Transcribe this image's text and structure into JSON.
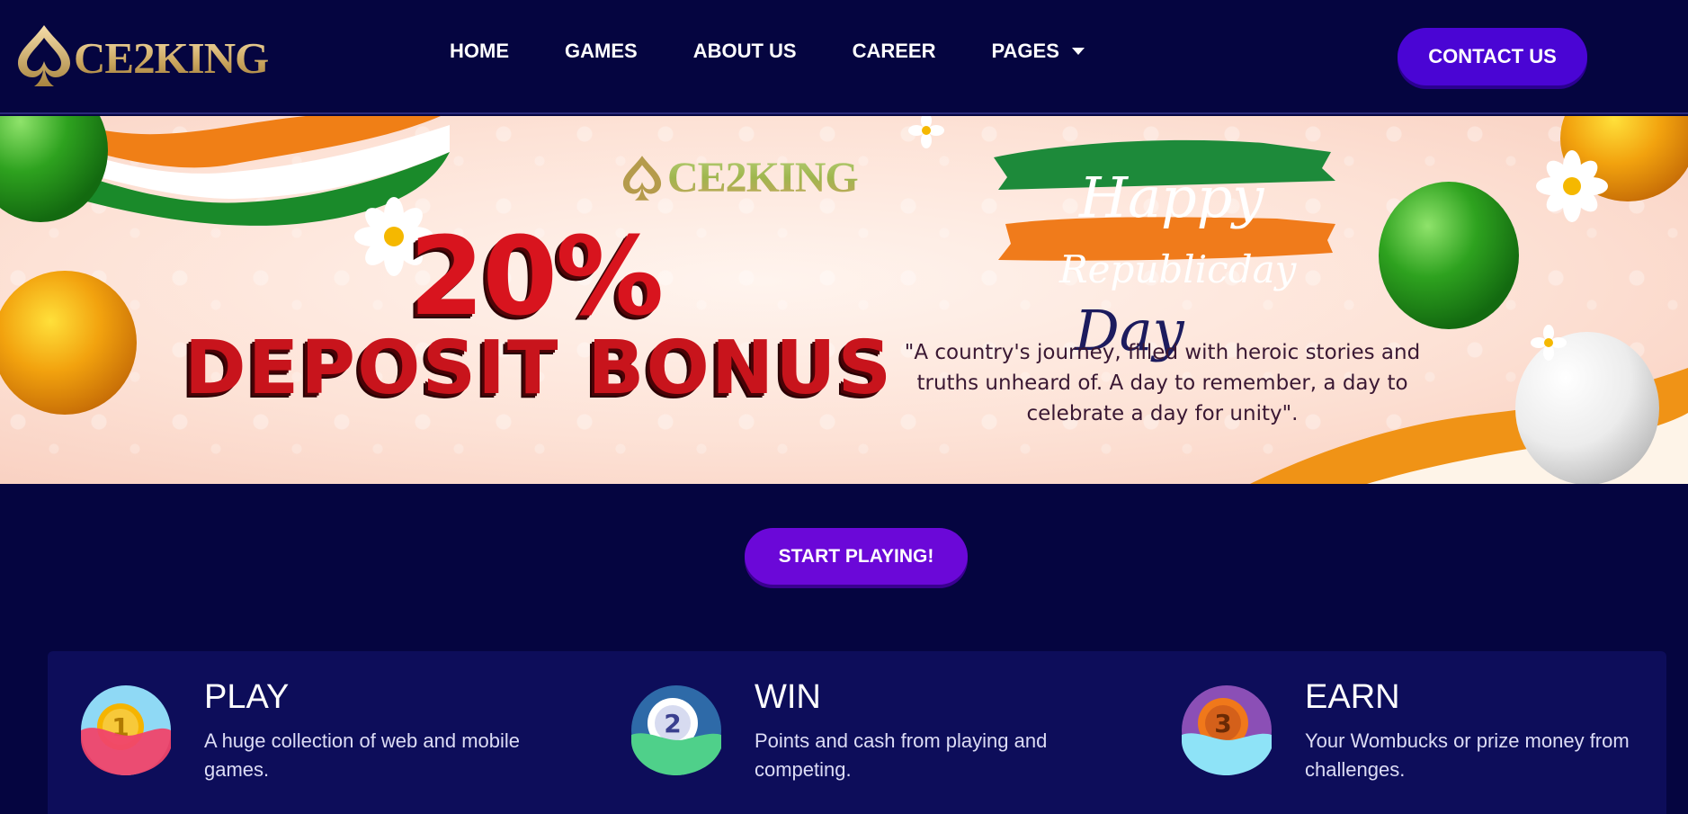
{
  "brand": {
    "logo_text": "CE2KING"
  },
  "nav": {
    "items": [
      {
        "label": "HOME"
      },
      {
        "label": "GAMES"
      },
      {
        "label": "ABOUT US"
      },
      {
        "label": "CAREER"
      },
      {
        "label": "PAGES",
        "has_dropdown": true
      }
    ],
    "contact_label": "CONTACT US"
  },
  "banner": {
    "logo_text": "CE2KING",
    "bonus_percent": "20%",
    "bonus_label": "DEPOSIT BONUS",
    "happy": "Happy",
    "republicday": "Republicday",
    "day": "Day",
    "quote": "\"A country's journey, filled with heroic stories and truths unheard of. A day to remember, a day to celebrate a day for unity\"."
  },
  "cta": {
    "start_label": "START PLAYING!"
  },
  "features": [
    {
      "number": "1",
      "title": "PLAY",
      "desc": "A huge collection of web and mobile games."
    },
    {
      "number": "2",
      "title": "WIN",
      "desc": "Points and cash from playing and competing."
    },
    {
      "number": "3",
      "title": "EARN",
      "desc": "Your Wombucks or prize money from challenges."
    }
  ],
  "colors": {
    "page_bg": "#050540",
    "panel_bg": "#0d0d5a",
    "contact_button": "#4a05d4",
    "start_button": "#6b08d8",
    "gold": "#c9a45c",
    "saffron": "#f07f16",
    "india_green": "#1a8a2a"
  },
  "icons": [
    "spade-icon",
    "chevron-down-icon",
    "medal-1-icon",
    "medal-2-icon",
    "medal-3-icon",
    "balloon-icon",
    "daisy-icon"
  ]
}
